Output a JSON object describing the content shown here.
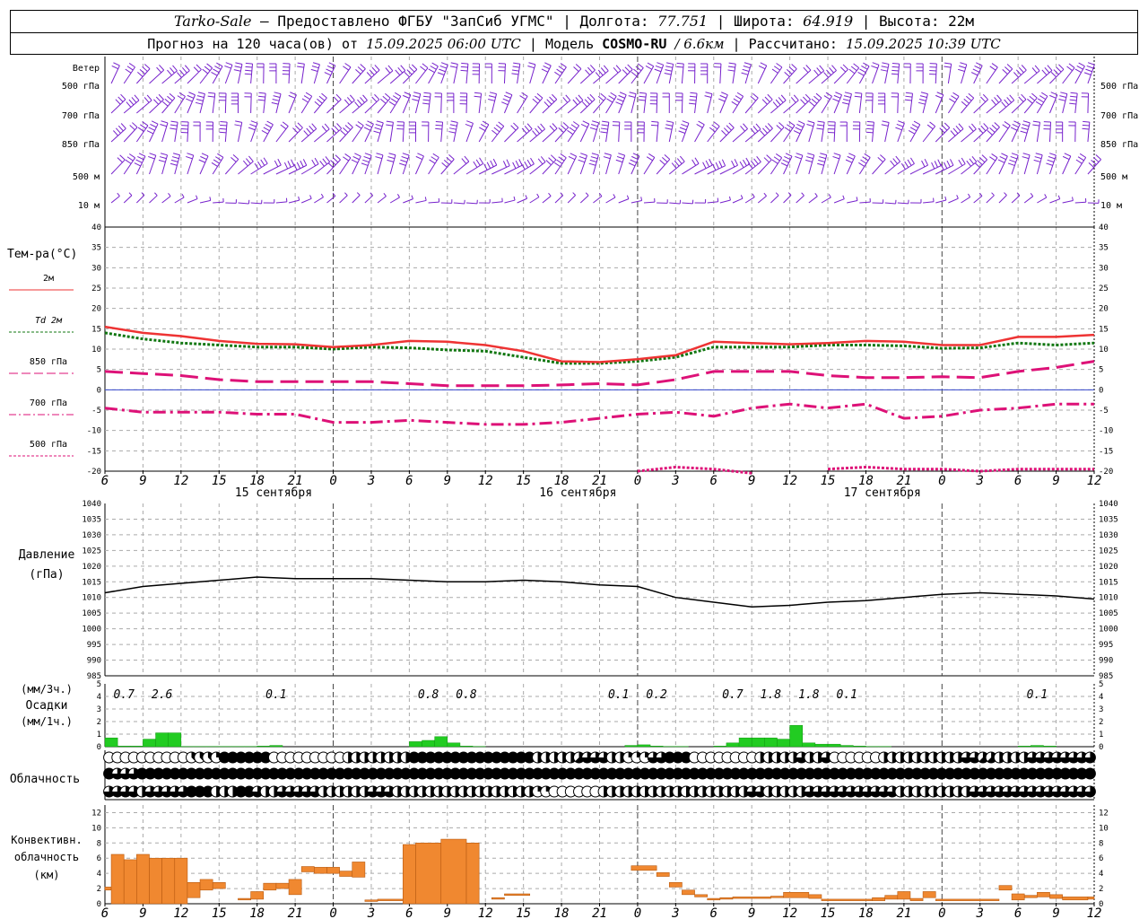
{
  "header": {
    "station": "Tarko-Sale",
    "provider": "– Предоставлено ФГБУ \"ЗапСиб УГМС\"",
    "lon_label": "Долгота:",
    "lon": "77.751",
    "lat_label": "Широта:",
    "lat": "64.919",
    "alt_label": "Высота:",
    "alt": "22м",
    "forecast_label": "Прогноз на 120 часа(ов) от",
    "forecast_from": "15.09.2025 06:00 UTC",
    "model_label": "Модель",
    "model": "COSMO-RU",
    "model_res": "/ 6.6км",
    "calc_label": "Рассчитано:",
    "calc_time": "15.09.2025 10:39 UTC"
  },
  "labels": {
    "wind": "Ветер",
    "temp": "Тем-ра(°C)",
    "pressure": "Давление",
    "pressure_unit": "(гПа)",
    "precip_3h": "(мм/3ч.)",
    "precip": "Осадки",
    "precip_1h": "(мм/1ч.)",
    "cloud": "Облачность",
    "conv1": "Конвективн.",
    "conv2": "облачность",
    "conv3": "(км)"
  },
  "wind_levels": [
    "500 гПа",
    "700 гПа",
    "850 гПа",
    "500 м",
    "10 м"
  ],
  "temp_legend": [
    {
      "label": "2м",
      "color": "#ee3333",
      "style": "solid"
    },
    {
      "label": "Td  2м",
      "color": "#117711",
      "style": "dotted"
    },
    {
      "label": "850 гПа",
      "color": "#dd1177",
      "style": "dash"
    },
    {
      "label": "700 гПа",
      "color": "#dd1177",
      "style": "dashdot"
    },
    {
      "label": "500 гПа",
      "color": "#dd1177",
      "style": "dot"
    }
  ],
  "time_ticks": [
    "6",
    "9",
    "12",
    "15",
    "18",
    "21",
    "0",
    "3",
    "6",
    "9",
    "12",
    "15",
    "18",
    "21",
    "0",
    "3",
    "6",
    "9",
    "12",
    "15",
    "18",
    "21",
    "0",
    "3",
    "6",
    "9",
    "12"
  ],
  "day_labels": [
    {
      "h": 14,
      "text": "15 сентября"
    },
    {
      "h": 38,
      "text": "16 сентября"
    },
    {
      "h": 62,
      "text": "17 сентября"
    }
  ],
  "precip_totals": [
    {
      "h": 1.5,
      "text": "0.7"
    },
    {
      "h": 4.5,
      "text": "2.6"
    },
    {
      "h": 13.5,
      "text": "0.1"
    },
    {
      "h": 25.5,
      "text": "0.8"
    },
    {
      "h": 28.5,
      "text": "0.8"
    },
    {
      "h": 40.5,
      "text": "0.1"
    },
    {
      "h": 43.5,
      "text": "0.2"
    },
    {
      "h": 49.5,
      "text": "0.7"
    },
    {
      "h": 52.5,
      "text": "1.8"
    },
    {
      "h": 55.5,
      "text": "1.8"
    },
    {
      "h": 58.5,
      "text": "0.1"
    },
    {
      "h": 73.5,
      "text": "0.1"
    }
  ],
  "colors": {
    "wind": "#7722cc",
    "precip": "#22cc22",
    "conv": "#f08830",
    "pressure": "#000000"
  },
  "chart_data": {
    "type": "meteogram",
    "hours": [
      0,
      3,
      6,
      9,
      12,
      15,
      18,
      21,
      24,
      27,
      30,
      33,
      36,
      39,
      42,
      45,
      48,
      51,
      54,
      57,
      60,
      63,
      66,
      69,
      72,
      75,
      78
    ],
    "temperature": {
      "ylim": [
        -20,
        40
      ],
      "t2m": [
        15.5,
        14,
        13.2,
        12,
        11.3,
        11.2,
        10.5,
        11,
        12,
        11.8,
        11,
        9.5,
        7,
        6.8,
        7.5,
        8.5,
        11.8,
        11.5,
        11.2,
        11.5,
        12,
        11.8,
        11,
        11,
        13,
        13,
        13.5
      ],
      "td2m": [
        14,
        12.5,
        11.5,
        11,
        10.5,
        10.5,
        10,
        10.5,
        10.3,
        9.8,
        9.5,
        8,
        6.5,
        6.5,
        7,
        8,
        10.5,
        10.5,
        10.5,
        11,
        11,
        10.8,
        10.2,
        10.3,
        11.5,
        11,
        11.5
      ],
      "t850": [
        4.5,
        4,
        3.5,
        2.5,
        2,
        2,
        2,
        2,
        1.5,
        1,
        1,
        1,
        1.2,
        1.5,
        1.2,
        2.5,
        4.5,
        4.5,
        4.5,
        3.5,
        3,
        3,
        3.2,
        3,
        4.5,
        5.5,
        7
      ],
      "t700": [
        -4.5,
        -5.5,
        -5.5,
        -5.5,
        -6,
        -6,
        -8,
        -8,
        -7.5,
        -8,
        -8.5,
        -8.5,
        -8,
        -7,
        -6,
        -5.5,
        -6.5,
        -4.5,
        -3.5,
        -4.5,
        -3.5,
        -7,
        -6.5,
        -5,
        -4.5,
        -3.5,
        -3.5
      ],
      "t500": [
        null,
        null,
        null,
        null,
        null,
        null,
        null,
        null,
        null,
        null,
        null,
        null,
        null,
        null,
        -20,
        -19,
        -19.5,
        -20.5,
        null,
        -19.5,
        -19,
        -19.5,
        -19.5,
        -20,
        -19.5,
        -19.5,
        -19.5
      ]
    },
    "pressure": {
      "ylim": [
        985,
        1040
      ],
      "values": [
        1011.5,
        1013.5,
        1014.5,
        1015.5,
        1016.5,
        1016,
        1016,
        1016,
        1015.5,
        1015,
        1015,
        1015.5,
        1015,
        1014,
        1013.5,
        1010,
        1008.5,
        1007,
        1007.5,
        1008.5,
        1009,
        1010,
        1011,
        1011.5,
        1011,
        1010.5,
        1009.5
      ]
    },
    "precip_1h": {
      "ylim": [
        0,
        5
      ],
      "hours": [
        0.5,
        1.5,
        2.5,
        3.5,
        4.5,
        5.5,
        6.5,
        7.5,
        8.5,
        9.5,
        10.5,
        11.5,
        12.5,
        13.5,
        24.5,
        25.5,
        26.5,
        27.5,
        28.5,
        29.5,
        41.5,
        42.5,
        43.5,
        44.5,
        45.5,
        48.5,
        49.5,
        50.5,
        51.5,
        52.5,
        53.5,
        54.5,
        55.5,
        56.5,
        57.5,
        58.5,
        59.5,
        60.5,
        61.5,
        72.5,
        73.5,
        74.5
      ],
      "values": [
        0.7,
        0.05,
        0.05,
        0.6,
        1.1,
        1.1,
        0.02,
        0.02,
        0.02,
        0.02,
        0.02,
        0.02,
        0.05,
        0.1,
        0.4,
        0.5,
        0.8,
        0.3,
        0.05,
        0.02,
        0.1,
        0.15,
        0.05,
        0.02,
        0.02,
        0.05,
        0.3,
        0.7,
        0.7,
        0.7,
        0.6,
        1.7,
        0.3,
        0.2,
        0.2,
        0.1,
        0.05,
        0.02,
        0.02,
        0.05,
        0.1,
        0.05
      ]
    },
    "cloud": {
      "rows": [
        "high",
        "middle",
        "low"
      ],
      "high": [
        0,
        0,
        0,
        0,
        0,
        0,
        0,
        0,
        0,
        0,
        3,
        3,
        3,
        2,
        8,
        8,
        8,
        8,
        8,
        8,
        0,
        0,
        0,
        0,
        0,
        0,
        0,
        0,
        0,
        4,
        4,
        4,
        4,
        4,
        4,
        4,
        4,
        8,
        8,
        8,
        8,
        8,
        8,
        8,
        8,
        8,
        8,
        8,
        8,
        8,
        8,
        8,
        4,
        4,
        4,
        4,
        4,
        5,
        6,
        6,
        6,
        4,
        4,
        2,
        2,
        2,
        6,
        6,
        8,
        8,
        8,
        0,
        0,
        0,
        0,
        0,
        0,
        0,
        0,
        4,
        4,
        4,
        4,
        4,
        6,
        4,
        4,
        6,
        0,
        0,
        0,
        0,
        0,
        0,
        4,
        4,
        4,
        4,
        4,
        4,
        4,
        4,
        4,
        4,
        6,
        6,
        5,
        5,
        4,
        4,
        4,
        4,
        6,
        6,
        6,
        6,
        6,
        6,
        6,
        6
      ],
      "middle": [
        8,
        6,
        6,
        6,
        8,
        8,
        8,
        8,
        8,
        8,
        8,
        8,
        8,
        8,
        8,
        8,
        8,
        8,
        8,
        8,
        8,
        8,
        8,
        8,
        8,
        8,
        8,
        8,
        8,
        8,
        8,
        8,
        8,
        8,
        8,
        8,
        8,
        8,
        8,
        8,
        8,
        8,
        8,
        8,
        8,
        8,
        8,
        8,
        8,
        8,
        8,
        8,
        8,
        8,
        8,
        8,
        8,
        8,
        8,
        8,
        8,
        8,
        8,
        8,
        8,
        8,
        8,
        8,
        8,
        8,
        8,
        8,
        8,
        8,
        8,
        8,
        8,
        8,
        8,
        8,
        8,
        8,
        8,
        8,
        8,
        8,
        8,
        8,
        8,
        8,
        8,
        8,
        8,
        8,
        8,
        8,
        8,
        8,
        8,
        8,
        8,
        8,
        8,
        8,
        8,
        8,
        8,
        8,
        8,
        8,
        8,
        8,
        8,
        8,
        8,
        8,
        8,
        8,
        8,
        8
      ],
      "low": [
        6,
        6,
        6,
        6,
        4,
        6,
        6,
        6,
        6,
        6,
        8,
        8,
        8,
        4,
        4,
        4,
        8,
        8,
        6,
        4,
        4,
        6,
        6,
        6,
        6,
        6,
        4,
        4,
        4,
        4,
        4,
        4,
        6,
        6,
        6,
        4,
        4,
        4,
        4,
        4,
        4,
        4,
        4,
        4,
        4,
        4,
        4,
        4,
        4,
        4,
        4,
        4,
        2,
        2,
        0,
        0,
        0,
        0,
        0,
        0,
        4,
        4,
        4,
        4,
        4,
        4,
        4,
        4,
        4,
        4,
        4,
        4,
        4,
        4,
        4,
        4,
        4,
        4,
        6,
        6,
        4,
        4,
        4,
        4,
        4,
        6,
        6,
        6,
        6,
        6,
        6,
        6,
        6,
        6,
        6,
        6,
        4,
        4,
        4,
        4,
        4,
        4,
        4,
        4,
        4,
        6,
        6,
        6,
        6,
        6,
        6,
        6,
        6,
        6,
        6,
        6,
        6,
        6,
        6,
        6
      ]
    },
    "convective_cloud": {
      "ylim": [
        0,
        13
      ],
      "bars": [
        {
          "h0": 0,
          "h1": 0.5,
          "bot": 1.8,
          "top": 2.2
        },
        {
          "h0": 0.5,
          "h1": 1.5,
          "bot": 0,
          "top": 6.5
        },
        {
          "h0": 1.5,
          "h1": 2.5,
          "bot": 0,
          "top": 5.8
        },
        {
          "h0": 2.5,
          "h1": 3.5,
          "bot": 0,
          "top": 6.5
        },
        {
          "h0": 3.5,
          "h1": 4.5,
          "bot": 0,
          "top": 6
        },
        {
          "h0": 4.5,
          "h1": 5.5,
          "bot": 0,
          "top": 6
        },
        {
          "h0": 5.5,
          "h1": 6.5,
          "bot": 0,
          "top": 6
        },
        {
          "h0": 6.5,
          "h1": 7.5,
          "bot": 0.8,
          "top": 2.8
        },
        {
          "h0": 7.5,
          "h1": 8.5,
          "bot": 1.8,
          "top": 3.2
        },
        {
          "h0": 8.5,
          "h1": 9.5,
          "bot": 2,
          "top": 2.8
        },
        {
          "h0": 10.5,
          "h1": 11.5,
          "bot": 0.5,
          "top": 0.7
        },
        {
          "h0": 11.5,
          "h1": 12.5,
          "bot": 0.6,
          "top": 1.6
        },
        {
          "h0": 12.5,
          "h1": 13.5,
          "bot": 1.8,
          "top": 2.7
        },
        {
          "h0": 13.5,
          "h1": 14.5,
          "bot": 2,
          "top": 2.7
        },
        {
          "h0": 14.5,
          "h1": 15.5,
          "bot": 1.2,
          "top": 3.2
        },
        {
          "h0": 15.5,
          "h1": 16.5,
          "bot": 4.2,
          "top": 4.9
        },
        {
          "h0": 16.5,
          "h1": 17.5,
          "bot": 4,
          "top": 4.8
        },
        {
          "h0": 17.5,
          "h1": 18.5,
          "bot": 4,
          "top": 4.8
        },
        {
          "h0": 18.5,
          "h1": 19.5,
          "bot": 3.6,
          "top": 4.3
        },
        {
          "h0": 19.5,
          "h1": 20.5,
          "bot": 3.5,
          "top": 5.5
        },
        {
          "h0": 20.5,
          "h1": 21.5,
          "bot": 0.3,
          "top": 0.5
        },
        {
          "h0": 21.5,
          "h1": 23.5,
          "bot": 0.4,
          "top": 0.6
        },
        {
          "h0": 23.5,
          "h1": 24.5,
          "bot": 0,
          "top": 7.8
        },
        {
          "h0": 24.5,
          "h1": 26.5,
          "bot": 0,
          "top": 8
        },
        {
          "h0": 26.5,
          "h1": 28.5,
          "bot": 0,
          "top": 8.5
        },
        {
          "h0": 28.5,
          "h1": 29.5,
          "bot": 0,
          "top": 8
        },
        {
          "h0": 30.5,
          "h1": 31.5,
          "bot": 0.6,
          "top": 0.8
        },
        {
          "h0": 31.5,
          "h1": 33.5,
          "bot": 1.1,
          "top": 1.3
        },
        {
          "h0": 41.5,
          "h1": 43.5,
          "bot": 4.4,
          "top": 5
        },
        {
          "h0": 43.5,
          "h1": 44.5,
          "bot": 3.6,
          "top": 4.1
        },
        {
          "h0": 44.5,
          "h1": 45.5,
          "bot": 2.2,
          "top": 2.8
        },
        {
          "h0": 45.5,
          "h1": 46.5,
          "bot": 1.2,
          "top": 1.8
        },
        {
          "h0": 46.5,
          "h1": 47.5,
          "bot": 0.9,
          "top": 1.2
        },
        {
          "h0": 47.5,
          "h1": 48.5,
          "bot": 0.5,
          "top": 0.7
        },
        {
          "h0": 48.5,
          "h1": 49.5,
          "bot": 0.6,
          "top": 0.8
        },
        {
          "h0": 49.5,
          "h1": 52.5,
          "bot": 0.7,
          "top": 0.9
        },
        {
          "h0": 52.5,
          "h1": 53.5,
          "bot": 0.8,
          "top": 1
        },
        {
          "h0": 53.5,
          "h1": 55.5,
          "bot": 0.8,
          "top": 1.5
        },
        {
          "h0": 55.5,
          "h1": 56.5,
          "bot": 0.7,
          "top": 1.2
        },
        {
          "h0": 56.5,
          "h1": 60.5,
          "bot": 0.4,
          "top": 0.6
        },
        {
          "h0": 60.5,
          "h1": 61.5,
          "bot": 0.4,
          "top": 0.8
        },
        {
          "h0": 61.5,
          "h1": 62.5,
          "bot": 0.6,
          "top": 1.1
        },
        {
          "h0": 62.5,
          "h1": 63.5,
          "bot": 0.6,
          "top": 1.6
        },
        {
          "h0": 63.5,
          "h1": 64.5,
          "bot": 0.4,
          "top": 0.7
        },
        {
          "h0": 64.5,
          "h1": 65.5,
          "bot": 0.8,
          "top": 1.6
        },
        {
          "h0": 65.5,
          "h1": 70.5,
          "bot": 0.4,
          "top": 0.6
        },
        {
          "h0": 70.5,
          "h1": 71.5,
          "bot": 1.8,
          "top": 2.4
        },
        {
          "h0": 71.5,
          "h1": 72.5,
          "bot": 0.5,
          "top": 1.3
        },
        {
          "h0": 72.5,
          "h1": 73.5,
          "bot": 0.8,
          "top": 1.1
        },
        {
          "h0": 73.5,
          "h1": 74.5,
          "bot": 0.9,
          "top": 1.5
        },
        {
          "h0": 74.5,
          "h1": 75.5,
          "bot": 0.7,
          "top": 1.2
        },
        {
          "h0": 75.5,
          "h1": 77.5,
          "bot": 0.5,
          "top": 0.9
        },
        {
          "h0": 77.5,
          "h1": 78,
          "bot": 0.6,
          "top": 0.9
        }
      ]
    }
  }
}
